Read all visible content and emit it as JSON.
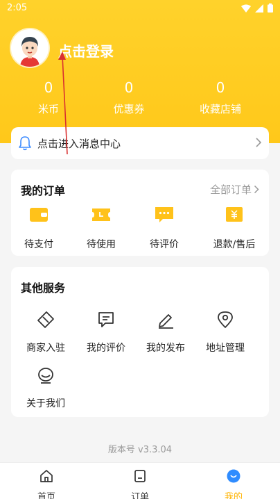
{
  "status_bar": {
    "time": "2:05"
  },
  "profile": {
    "login_text": "点击登录"
  },
  "stats": [
    {
      "value": "0",
      "label": "米币"
    },
    {
      "value": "0",
      "label": "优惠券"
    },
    {
      "value": "0",
      "label": "收藏店铺"
    }
  ],
  "message_center": {
    "label": "点击进入消息中心"
  },
  "orders": {
    "title": "我的订单",
    "all_label": "全部订单",
    "items": [
      {
        "label": "待支付",
        "icon": "wallet-icon"
      },
      {
        "label": "待使用",
        "icon": "ticket-icon"
      },
      {
        "label": "待评价",
        "icon": "comment-icon"
      },
      {
        "label": "退款/售后",
        "icon": "refund-icon"
      }
    ]
  },
  "services": {
    "title": "其他服务",
    "items": [
      {
        "label": "商家入驻",
        "icon": "merchant-icon"
      },
      {
        "label": "我的评价",
        "icon": "review-icon"
      },
      {
        "label": "我的发布",
        "icon": "edit-icon"
      },
      {
        "label": "地址管理",
        "icon": "location-icon"
      },
      {
        "label": "关于我们",
        "icon": "about-icon"
      }
    ]
  },
  "version": "版本号 v3.3.04",
  "tabs": [
    {
      "label": "首页",
      "icon": "home-icon"
    },
    {
      "label": "订单",
      "icon": "order-icon"
    },
    {
      "label": "我的",
      "icon": "profile-icon"
    }
  ],
  "colors": {
    "brand_yellow": "#ffc81a",
    "accent_yellow": "#ffb300",
    "active_tab_blue": "#2f8cff"
  }
}
